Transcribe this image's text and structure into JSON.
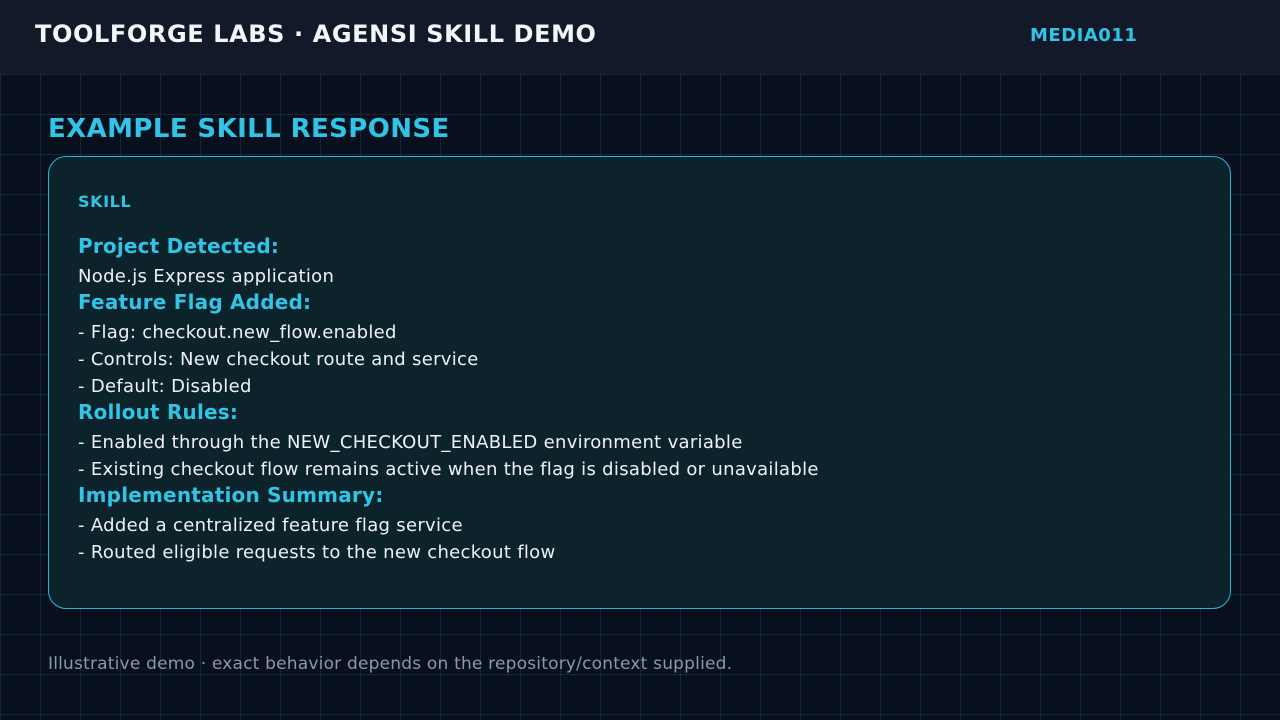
{
  "header": {
    "title": "TOOLFORGE LABS · AGENSI SKILL DEMO",
    "media_id": "MEDIA011"
  },
  "main": {
    "heading": "EXAMPLE SKILL RESPONSE",
    "card": {
      "label": "SKILL",
      "sections": [
        {
          "heading": "Project Detected:",
          "lines": [
            "Node.js Express application"
          ]
        },
        {
          "heading": "Feature Flag Added:",
          "lines": [
            "- Flag: checkout.new_flow.enabled",
            "- Controls: New checkout route and service",
            "- Default: Disabled"
          ]
        },
        {
          "heading": "Rollout Rules:",
          "lines": [
            "- Enabled through the NEW_CHECKOUT_ENABLED environment variable",
            "- Existing checkout flow remains active when the flag is disabled or unavailable"
          ]
        },
        {
          "heading": "Implementation Summary:",
          "lines": [
            "- Added a centralized feature flag service",
            "- Routed eligible requests to the new checkout flow"
          ]
        }
      ]
    }
  },
  "footer": {
    "note": "Illustrative demo · exact behavior depends on the repository/context supplied."
  },
  "colors": {
    "accent": "#31c4e6",
    "background": "#07101c",
    "header_background": "#121a2a",
    "card_background": "#0d232c",
    "card_border": "#2fb6d6",
    "muted_text": "#8b99aa"
  }
}
